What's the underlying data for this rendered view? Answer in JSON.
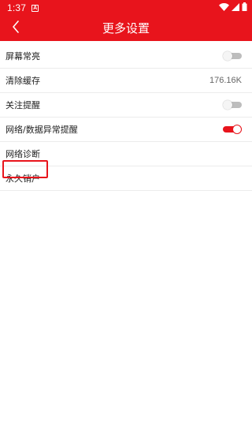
{
  "status_bar": {
    "time": "1:37",
    "notification_badge": "A",
    "icons": [
      "wifi-icon",
      "signal-icon",
      "battery-icon"
    ]
  },
  "nav": {
    "title": "更多设置",
    "back_icon": "chevron-left-icon"
  },
  "settings": [
    {
      "label": "屏幕常亮",
      "control": "toggle",
      "on": false
    },
    {
      "label": "清除缓存",
      "control": "value",
      "value": "176.16K"
    },
    {
      "label": "关注提醒",
      "control": "toggle",
      "on": false
    },
    {
      "label": "网络/数据异常提醒",
      "control": "toggle",
      "on": true
    },
    {
      "label": "网络诊断",
      "control": "none"
    },
    {
      "label": "永久销户",
      "control": "none",
      "highlighted": true
    }
  ],
  "colors": {
    "brand_red": "#e8141c",
    "toggle_off": "#bdbdbd",
    "divider": "#ececec"
  }
}
